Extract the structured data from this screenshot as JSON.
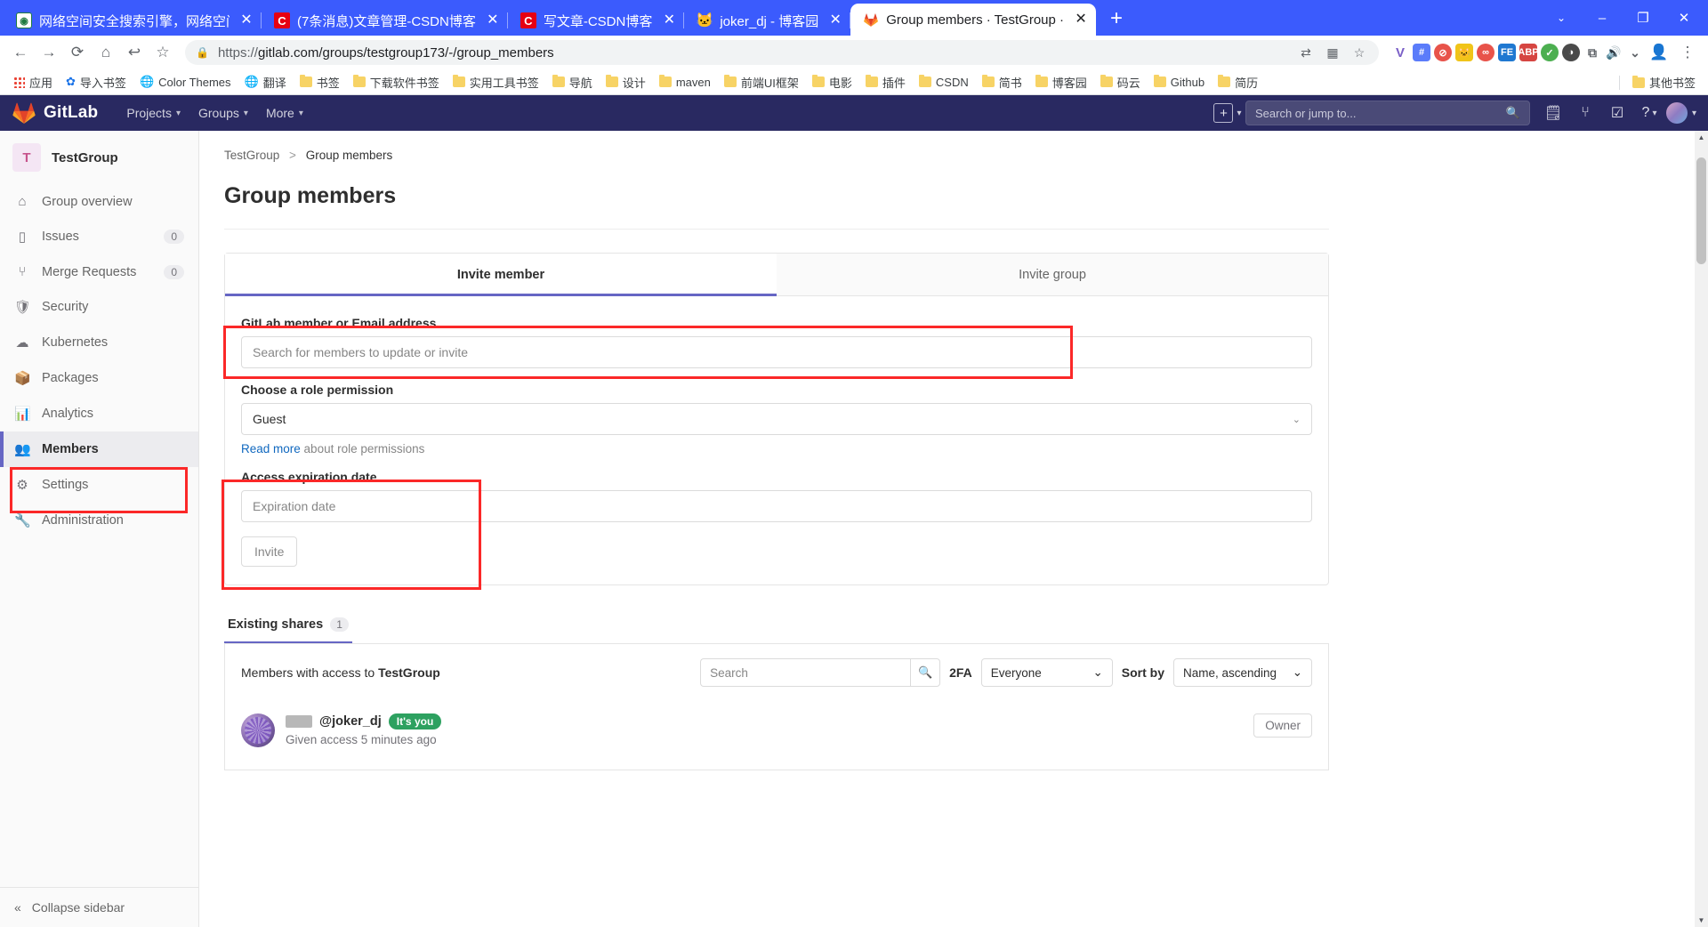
{
  "browser": {
    "tabs": [
      {
        "title": "网络空间安全搜索引擎，网络空间…",
        "icon": "shodan-icon",
        "active": false
      },
      {
        "title": "(7条消息)文章管理-CSDN博客",
        "icon": "csdn-icon",
        "active": false
      },
      {
        "title": "写文章-CSDN博客",
        "icon": "csdn-icon",
        "active": false
      },
      {
        "title": "joker_dj - 博客园",
        "icon": "cnblogs-icon",
        "active": false
      },
      {
        "title": "Group members · TestGroup ·",
        "icon": "gitlab-icon",
        "active": true
      }
    ],
    "close_label": "✕",
    "newtab_label": "+",
    "window_controls": {
      "list": "⌄",
      "minimize": "–",
      "maximize": "❐",
      "close": "✕"
    },
    "toolbar": {
      "back": "←",
      "forward": "→",
      "reload": "⟳",
      "home": "⌂",
      "undo": "↩",
      "bookmark_star": "☆",
      "lock": "🔒",
      "url_scheme": "https://",
      "url_rest": "gitlab.com/groups/testgroup173/-/group_members",
      "translate": "⇄",
      "grid": "▦",
      "star": "☆",
      "profile": "👤",
      "menu": "⋮"
    },
    "bookmarks": [
      {
        "label": "应用",
        "icon": "apps-grid-icon"
      },
      {
        "label": "导入书签",
        "icon": "gear-icon"
      },
      {
        "label": "Color Themes",
        "icon": "globe-icon"
      },
      {
        "label": "翻译",
        "icon": "globe-icon"
      },
      {
        "label": "书签",
        "icon": "folder-icon"
      },
      {
        "label": "下载软件书签",
        "icon": "folder-icon"
      },
      {
        "label": "实用工具书签",
        "icon": "folder-icon"
      },
      {
        "label": "导航",
        "icon": "folder-icon"
      },
      {
        "label": "设计",
        "icon": "folder-icon"
      },
      {
        "label": "maven",
        "icon": "folder-icon"
      },
      {
        "label": "前端UI框架",
        "icon": "folder-icon"
      },
      {
        "label": "电影",
        "icon": "folder-icon"
      },
      {
        "label": "插件",
        "icon": "folder-icon"
      },
      {
        "label": "CSDN",
        "icon": "folder-icon"
      },
      {
        "label": "简书",
        "icon": "folder-icon"
      },
      {
        "label": "博客园",
        "icon": "folder-icon"
      },
      {
        "label": "码云",
        "icon": "folder-icon"
      },
      {
        "label": "Github",
        "icon": "folder-icon"
      },
      {
        "label": "简历",
        "icon": "folder-icon"
      }
    ],
    "bookmarks_other": {
      "label": "其他书签",
      "icon": "folder-icon"
    }
  },
  "gitlab": {
    "brand": "GitLab",
    "nav": [
      {
        "label": "Projects"
      },
      {
        "label": "Groups"
      },
      {
        "label": "More"
      }
    ],
    "search_placeholder": "Search or jump to...",
    "nav_icons": [
      "plus-square-icon",
      "issues-icon",
      "merge-requests-icon",
      "todos-icon",
      "help-icon",
      "avatar-icon"
    ]
  },
  "sidebar": {
    "group_initial": "T",
    "group_name": "TestGroup",
    "items": [
      {
        "label": "Group overview",
        "icon": "home-icon",
        "badge": "",
        "active": false
      },
      {
        "label": "Issues",
        "icon": "issue-icon",
        "badge": "0",
        "active": false
      },
      {
        "label": "Merge Requests",
        "icon": "merge-icon",
        "badge": "0",
        "active": false
      },
      {
        "label": "Security",
        "icon": "shield-icon",
        "badge": "",
        "active": false
      },
      {
        "label": "Kubernetes",
        "icon": "kubernetes-icon",
        "badge": "",
        "active": false
      },
      {
        "label": "Packages",
        "icon": "package-icon",
        "badge": "",
        "active": false
      },
      {
        "label": "Analytics",
        "icon": "analytics-icon",
        "badge": "",
        "active": false
      },
      {
        "label": "Members",
        "icon": "members-icon",
        "badge": "",
        "active": true
      },
      {
        "label": "Settings",
        "icon": "gear-icon",
        "badge": "",
        "active": false
      },
      {
        "label": "Administration",
        "icon": "admin-icon",
        "badge": "",
        "active": false
      }
    ],
    "collapse_label": "Collapse sidebar",
    "collapse_icon": "chevrons-left-icon"
  },
  "main": {
    "breadcrumb": {
      "group": "TestGroup",
      "separator": ">",
      "current": "Group members"
    },
    "page_title": "Group members",
    "invite": {
      "tabs": [
        {
          "label": "Invite member",
          "active": true
        },
        {
          "label": "Invite group",
          "active": false
        }
      ],
      "member_field_label": "GitLab member or Email address",
      "member_field_placeholder": "Search for members to update or invite",
      "role_label": "Choose a role permission",
      "role_value": "Guest",
      "readmore_link": "Read more",
      "readmore_rest": " about role permissions",
      "expiration_label": "Access expiration date",
      "expiration_placeholder": "Expiration date",
      "invite_button": "Invite"
    },
    "shares": {
      "tab_label": "Existing shares",
      "tab_count": "1",
      "members_with_access_prefix": "Members with access to ",
      "members_with_access_group": "TestGroup",
      "search_placeholder": "Search",
      "search_icon": "search-icon",
      "twofa_label": "2FA",
      "twofa_value": "Everyone",
      "sort_label": "Sort by",
      "sort_value": "Name, ascending",
      "rows": [
        {
          "handle": "@joker_dj",
          "badge": "It's you",
          "sub": "Given access 5 minutes ago",
          "role": "Owner"
        }
      ]
    }
  },
  "annotations": {
    "boxes": [
      {
        "name": "search-input-highlight"
      },
      {
        "name": "members-sidebar-highlight"
      },
      {
        "name": "expiration-section-highlight"
      }
    ],
    "color": "#fb2828"
  }
}
